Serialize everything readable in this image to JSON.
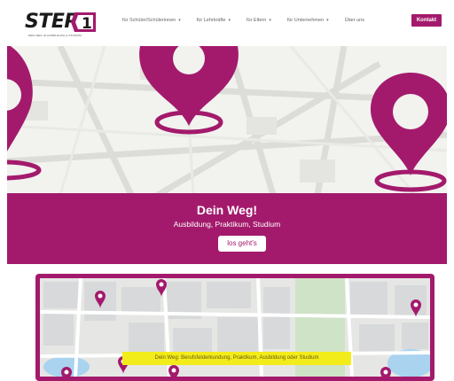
{
  "header": {
    "logo": "STEP1",
    "logo_tagline": "DEIN WEG IN AUSBILDUNG & STUDIUM",
    "nav": [
      {
        "label": "für Schüler/Schülerinnen",
        "has_dropdown": true
      },
      {
        "label": "für Lehrkräfte",
        "has_dropdown": true
      },
      {
        "label": "für Eltern",
        "has_dropdown": true
      },
      {
        "label": "für Unternehmen",
        "has_dropdown": true
      },
      {
        "label": "Über uns",
        "has_dropdown": false
      }
    ],
    "contact_label": "Kontakt"
  },
  "hero": {
    "icon": "map-pin-icon"
  },
  "banner": {
    "title": "Dein Weg!",
    "subtitle": "Ausbildung, Praktikum, Studium",
    "cta_label": "los geht's"
  },
  "map_card": {
    "caption": "Dein Weg: Berufsfelderkundung, Praktikum, Ausbildung oder Studium"
  },
  "colors": {
    "brand": "#a31a6c",
    "caption_bg": "#f3ec1b"
  }
}
